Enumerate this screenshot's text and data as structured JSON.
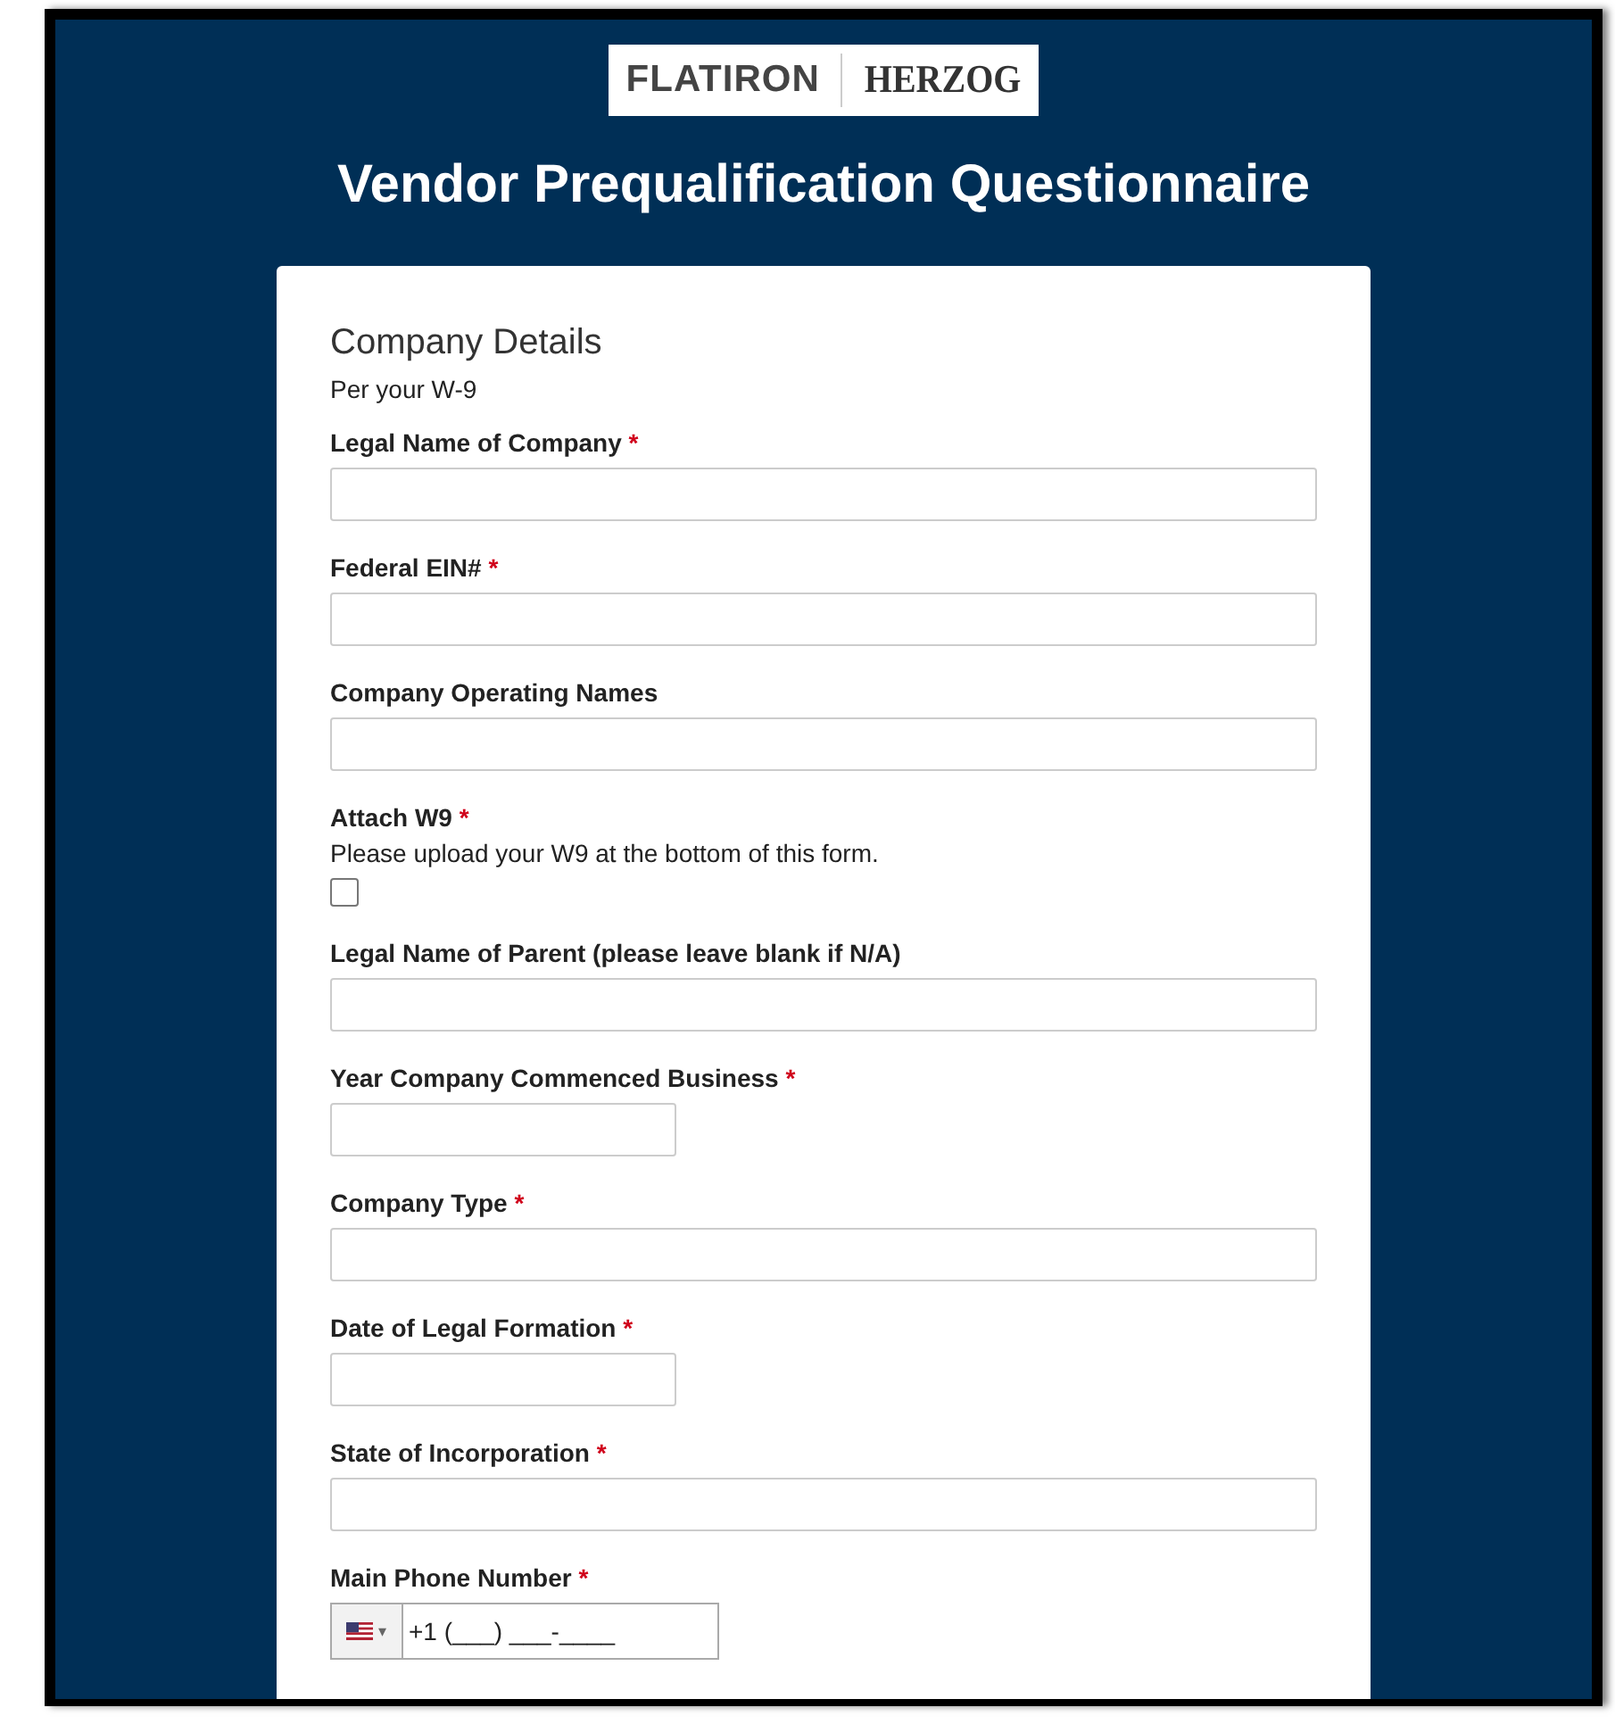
{
  "logo": {
    "left": "FLATIRON",
    "right": "HERZOG"
  },
  "title": "Vendor Prequalification Questionnaire",
  "section": {
    "title": "Company Details",
    "subtitle": "Per your W-9"
  },
  "fields": [
    {
      "kind": "wide",
      "label": "Legal Name of Company",
      "required_mark": "*"
    },
    {
      "kind": "wide",
      "label": "Federal EIN#",
      "required_mark": "*"
    },
    {
      "kind": "wide",
      "label": "Company Operating Names"
    },
    {
      "kind": "checkbox",
      "label": "Attach W9",
      "required_mark": "*",
      "description": "Please upload your W9 at the bottom of this form.",
      "checked": false
    },
    {
      "kind": "wide",
      "label": "Legal Name of Parent (please leave blank if N/A)"
    },
    {
      "kind": "short",
      "label": "Year Company Commenced Business",
      "required_mark": "*"
    },
    {
      "kind": "wide",
      "label": "Company Type",
      "required_mark": "*"
    },
    {
      "kind": "short",
      "label": "Date of Legal Formation",
      "required_mark": "*"
    },
    {
      "kind": "wide",
      "label": "State of Incorporation",
      "required_mark": "*"
    },
    {
      "kind": "phone",
      "label": "Main Phone Number",
      "required_mark": "*",
      "value": "+1 (___) ___-____",
      "caret": "▾"
    }
  ]
}
